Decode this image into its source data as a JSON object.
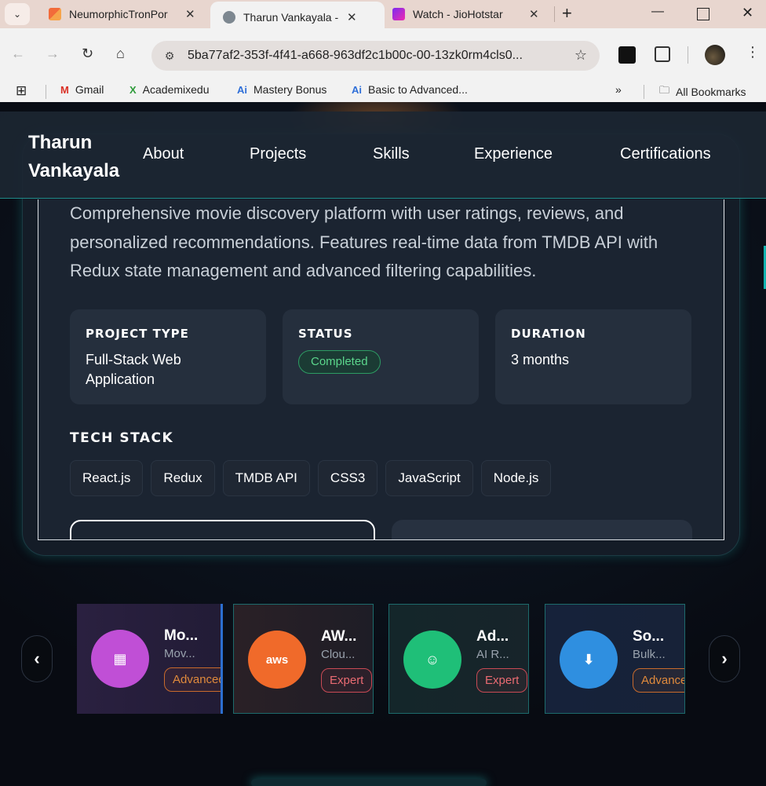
{
  "browser": {
    "tabs": [
      {
        "title": "NeumorphicTronPor",
        "active": false
      },
      {
        "title": "Tharun Vankayala - ",
        "active": true
      },
      {
        "title": "Watch - JioHotstar",
        "active": false
      }
    ],
    "url": "5ba77af2-353f-4f41-a668-963df2c1b00c-00-13zk0rm4cls0...",
    "bookmarks": [
      "Gmail",
      "Academixedu",
      "Mastery Bonus",
      "Basic to Advanced...",
      "All Bookmarks"
    ]
  },
  "site": {
    "brand": "Tharun Vankayala",
    "nav": [
      "About",
      "Projects",
      "Skills",
      "Experience",
      "Certifications"
    ]
  },
  "project": {
    "description": "Comprehensive movie discovery platform with user ratings, reviews, and personalized recommendations. Features real-time data from TMDB API with Redux state management and advanced filtering capabilities.",
    "meta": [
      {
        "label": "PROJECT TYPE",
        "value": "Full-Stack Web Application"
      },
      {
        "label": "STATUS",
        "value": "Completed"
      },
      {
        "label": "DURATION",
        "value": "3 months"
      }
    ],
    "tech_stack_title": "TECH STACK",
    "tech_stack": [
      "React.js",
      "Redux",
      "TMDB API",
      "CSS3",
      "JavaScript",
      "Node.js"
    ]
  },
  "skills_carousel": [
    {
      "name": "Mo...",
      "sub": "Mov...",
      "level": "Advanced",
      "icon": "film-icon",
      "color": "#c04fd6"
    },
    {
      "name": "AW...",
      "sub": "Clou...",
      "level": "Expert",
      "icon": "aws-icon",
      "color": "#f06a2a"
    },
    {
      "name": "Ad...",
      "sub": "AI R...",
      "level": "Expert",
      "icon": "robot-icon",
      "color": "#1fbf78"
    },
    {
      "name": "So...",
      "sub": "Bulk...",
      "level": "Advanced",
      "icon": "download-icon",
      "color": "#2f8fe0"
    }
  ]
}
